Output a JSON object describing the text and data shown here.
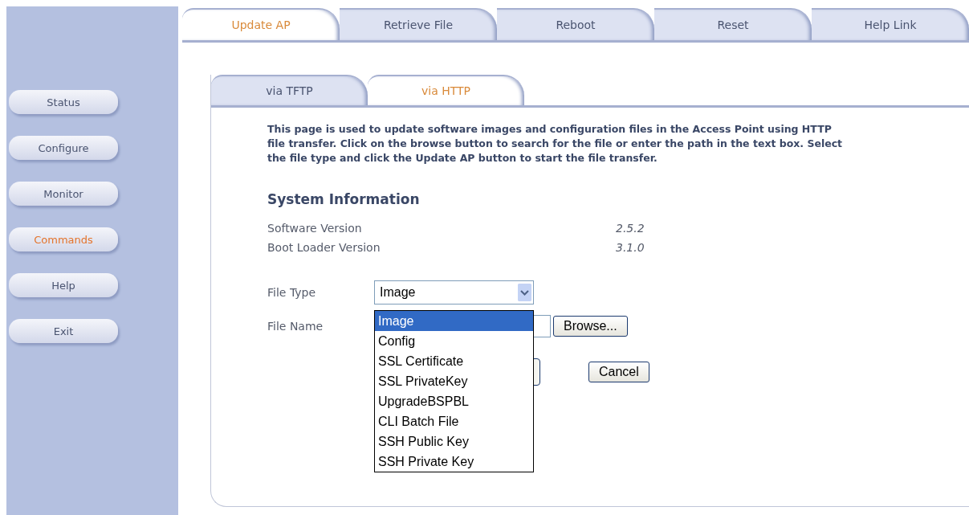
{
  "sidebar": {
    "items": [
      {
        "label": "Status",
        "selected": false
      },
      {
        "label": "Configure",
        "selected": false
      },
      {
        "label": "Monitor",
        "selected": false
      },
      {
        "label": "Commands",
        "selected": true
      },
      {
        "label": "Help",
        "selected": false
      },
      {
        "label": "Exit",
        "selected": false
      }
    ]
  },
  "tabs": [
    {
      "label": "Update AP",
      "selected": true
    },
    {
      "label": "Retrieve File",
      "selected": false
    },
    {
      "label": "Reboot",
      "selected": false
    },
    {
      "label": "Reset",
      "selected": false
    },
    {
      "label": "Help Link",
      "selected": false
    }
  ],
  "subtabs": [
    {
      "label": "via TFTP",
      "selected": false
    },
    {
      "label": "via HTTP",
      "selected": true
    }
  ],
  "description": "This page is used to update software images and configuration files in the Access Point using HTTP file transfer. Click on the browse button to search for the file or enter the path in the text box. Select the file type and click the Update AP button to start the file transfer.",
  "system_information": {
    "title": "System Information",
    "rows": [
      {
        "label": "Software Version",
        "value": "2.5.2"
      },
      {
        "label": "Boot Loader Version",
        "value": "3.1.0"
      }
    ]
  },
  "form": {
    "file_type_label": "File Type",
    "file_type_value": "Image",
    "file_name_label": "File Name",
    "browse_button": "Browse...",
    "cancel_button": "Cancel",
    "options": [
      {
        "label": "Image",
        "selected": true
      },
      {
        "label": "Config",
        "selected": false
      },
      {
        "label": "SSL Certificate",
        "selected": false
      },
      {
        "label": "SSL PrivateKey",
        "selected": false
      },
      {
        "label": "UpgradeBSPBL",
        "selected": false
      },
      {
        "label": "CLI Batch File",
        "selected": false
      },
      {
        "label": "SSH Public Key",
        "selected": false
      },
      {
        "label": "SSH Private Key",
        "selected": false
      }
    ]
  }
}
